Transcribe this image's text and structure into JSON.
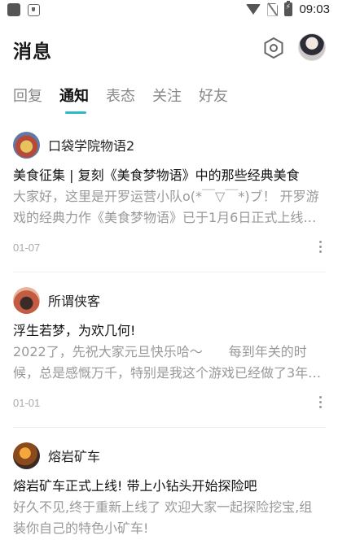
{
  "status_bar": {
    "time": "09:03"
  },
  "header": {
    "title": "消息"
  },
  "tabs": [
    {
      "label": "回复",
      "active": false
    },
    {
      "label": "通知",
      "active": true
    },
    {
      "label": "表态",
      "active": false
    },
    {
      "label": "关注",
      "active": false
    },
    {
      "label": "好友",
      "active": false
    }
  ],
  "accent_color": "#2fb8c8",
  "notifications": [
    {
      "name": "口袋学院物语2",
      "title": "美食征集 | 复刻《美食梦物语》中的那些经典美食",
      "body_line1": "大家好，这里是开罗运营小队o(*￣▽￣*)ブ！ 开罗游",
      "body_line2": "戏的经典力作《美食梦物语》已于1月6日正式上线…",
      "date": "01-07"
    },
    {
      "name": "所谓侠客",
      "title": "浮生若梦，为欢几何!",
      "body_line1": "2022了，先祝大家元旦快乐哈～　　每到年关的时",
      "body_line2": "候，总是感慨万千，特别是我这个游戏已经做了3年…",
      "date": "01-01"
    },
    {
      "name": "熔岩矿车",
      "title": "熔岩矿车正式上线! 带上小钻头开始探险吧",
      "body_line1": "好久不见,终于重新上线了 欢迎大家一起探险挖宝,组",
      "body_line2": "装你自己的特色小矿车!",
      "date": ""
    }
  ]
}
